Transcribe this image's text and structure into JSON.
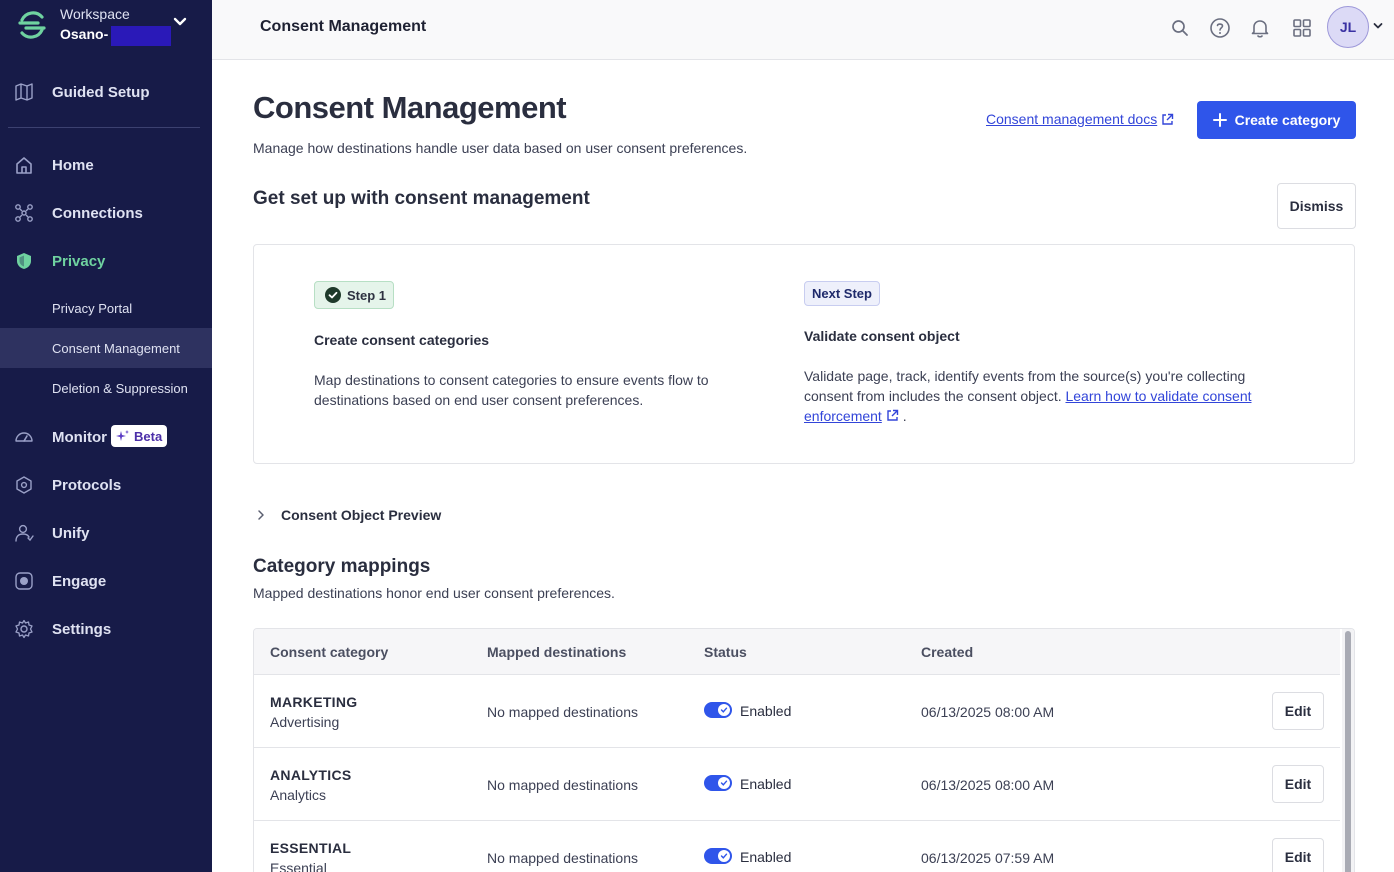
{
  "workspace": {
    "label": "Workspace",
    "name": "Osano-"
  },
  "sidebar": {
    "guided_setup": "Guided Setup",
    "items": [
      {
        "label": "Home"
      },
      {
        "label": "Connections"
      },
      {
        "label": "Privacy"
      },
      {
        "label": "Monitor"
      },
      {
        "label": "Protocols"
      },
      {
        "label": "Unify"
      },
      {
        "label": "Engage"
      },
      {
        "label": "Settings"
      }
    ],
    "privacy_sub": [
      {
        "label": "Privacy Portal"
      },
      {
        "label": "Consent Management"
      },
      {
        "label": "Deletion & Suppression"
      }
    ],
    "beta_badge": "Beta"
  },
  "topbar": {
    "title": "Consent Management",
    "avatar_initials": "JL"
  },
  "page": {
    "title": "Consent Management",
    "subtitle": "Manage how destinations handle user data based on user consent preferences.",
    "docs_link": "Consent management docs",
    "create_button": "Create category"
  },
  "setup": {
    "title": "Get set up with consent management",
    "dismiss": "Dismiss",
    "step1": {
      "badge": "Step 1",
      "heading": "Create consent categories",
      "desc_line1": "Map destinations to consent categories to ensure events flow to",
      "desc_line2": "destinations based on end user consent preferences."
    },
    "next_step": {
      "badge": "Next Step",
      "heading": "Validate consent object",
      "desc_line1": "Validate page, track, identify events from the source(s) you're collecting",
      "desc_line2_prefix": "consent from includes the consent object.",
      "link_part1": "Learn how to validate consent",
      "link_part2": "enforcement",
      "suffix": "."
    }
  },
  "preview": {
    "label": "Consent Object Preview"
  },
  "mappings": {
    "title": "Category mappings",
    "subtitle": "Mapped destinations honor end user consent preferences.",
    "columns": [
      "Consent category",
      "Mapped destinations",
      "Status",
      "Created"
    ],
    "rows": [
      {
        "name": "MARKETING",
        "sub": "Advertising",
        "mapped": "No mapped destinations",
        "status": "Enabled",
        "created": "06/13/2025 08:00 AM",
        "edit": "Edit"
      },
      {
        "name": "ANALYTICS",
        "sub": "Analytics",
        "mapped": "No mapped destinations",
        "status": "Enabled",
        "created": "06/13/2025 08:00 AM",
        "edit": "Edit"
      },
      {
        "name": "ESSENTIAL",
        "sub": "Essential",
        "mapped": "No mapped destinations",
        "status": "Enabled",
        "created": "06/13/2025 07:59 AM",
        "edit": "Edit"
      }
    ]
  },
  "colors": {
    "sidebar_bg": "#171b48",
    "accent": "#2f55ea",
    "active_nav": "#6fd2a0",
    "link": "#3245d9"
  }
}
